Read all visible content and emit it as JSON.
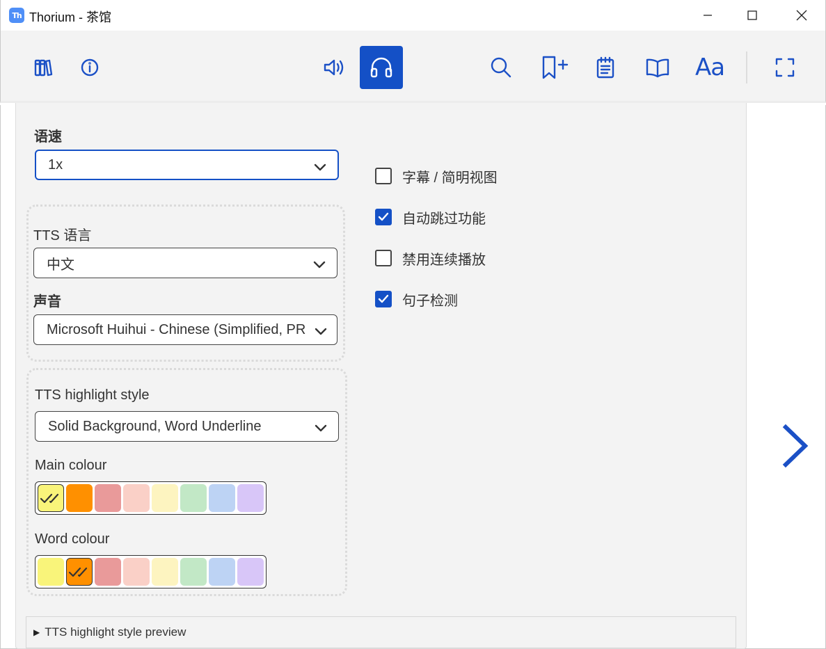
{
  "window": {
    "app_icon_text": "Th",
    "title": "Thorium - 茶馆"
  },
  "toolbar": {
    "left": [
      {
        "icon": "library-icon"
      },
      {
        "icon": "info-icon"
      }
    ],
    "center": [
      {
        "icon": "speaker-icon",
        "active": false
      },
      {
        "icon": "headphones-icon",
        "active": true
      }
    ],
    "right": [
      {
        "icon": "search-icon"
      },
      {
        "icon": "bookmark-add-icon"
      },
      {
        "icon": "notes-icon"
      },
      {
        "icon": "book-open-icon"
      },
      {
        "icon": "text-settings-icon",
        "text": "Aa"
      },
      {
        "icon": "fullscreen-icon"
      }
    ]
  },
  "panel": {
    "speed": {
      "label": "语速",
      "value": "1x"
    },
    "tts_language": {
      "label": "TTS 语言",
      "value": "中文"
    },
    "voice": {
      "label": "声音",
      "value": "Microsoft Huihui - Chinese (Simplified, PRC)"
    },
    "highlight_style": {
      "label": "TTS highlight style",
      "value": "Solid Background, Word Underline"
    },
    "main_colour": {
      "label": "Main colour",
      "colors": [
        "#f9f47a",
        "#ff9000",
        "#e99a9a",
        "#fad0c7",
        "#fdf4c0",
        "#c2e8c6",
        "#bdd3f4",
        "#d8c6f8"
      ],
      "selected_index": 0
    },
    "word_colour": {
      "label": "Word colour",
      "colors": [
        "#f9f47a",
        "#ff9000",
        "#e99a9a",
        "#fad0c7",
        "#fdf4c0",
        "#c2e8c6",
        "#bdd3f4",
        "#d8c6f8"
      ],
      "selected_index": 1
    },
    "checkboxes": [
      {
        "label": "字幕 / 简明视图",
        "checked": false
      },
      {
        "label": "自动跳过功能",
        "checked": true
      },
      {
        "label": "禁用连续播放",
        "checked": false
      },
      {
        "label": "句子检测",
        "checked": true
      }
    ],
    "preview": {
      "label": "TTS highlight style preview"
    }
  },
  "colors": {
    "accent": "#1450c6",
    "toolbar_bg": "#f3f3f3",
    "panel_bg": "#f3f3f3"
  }
}
